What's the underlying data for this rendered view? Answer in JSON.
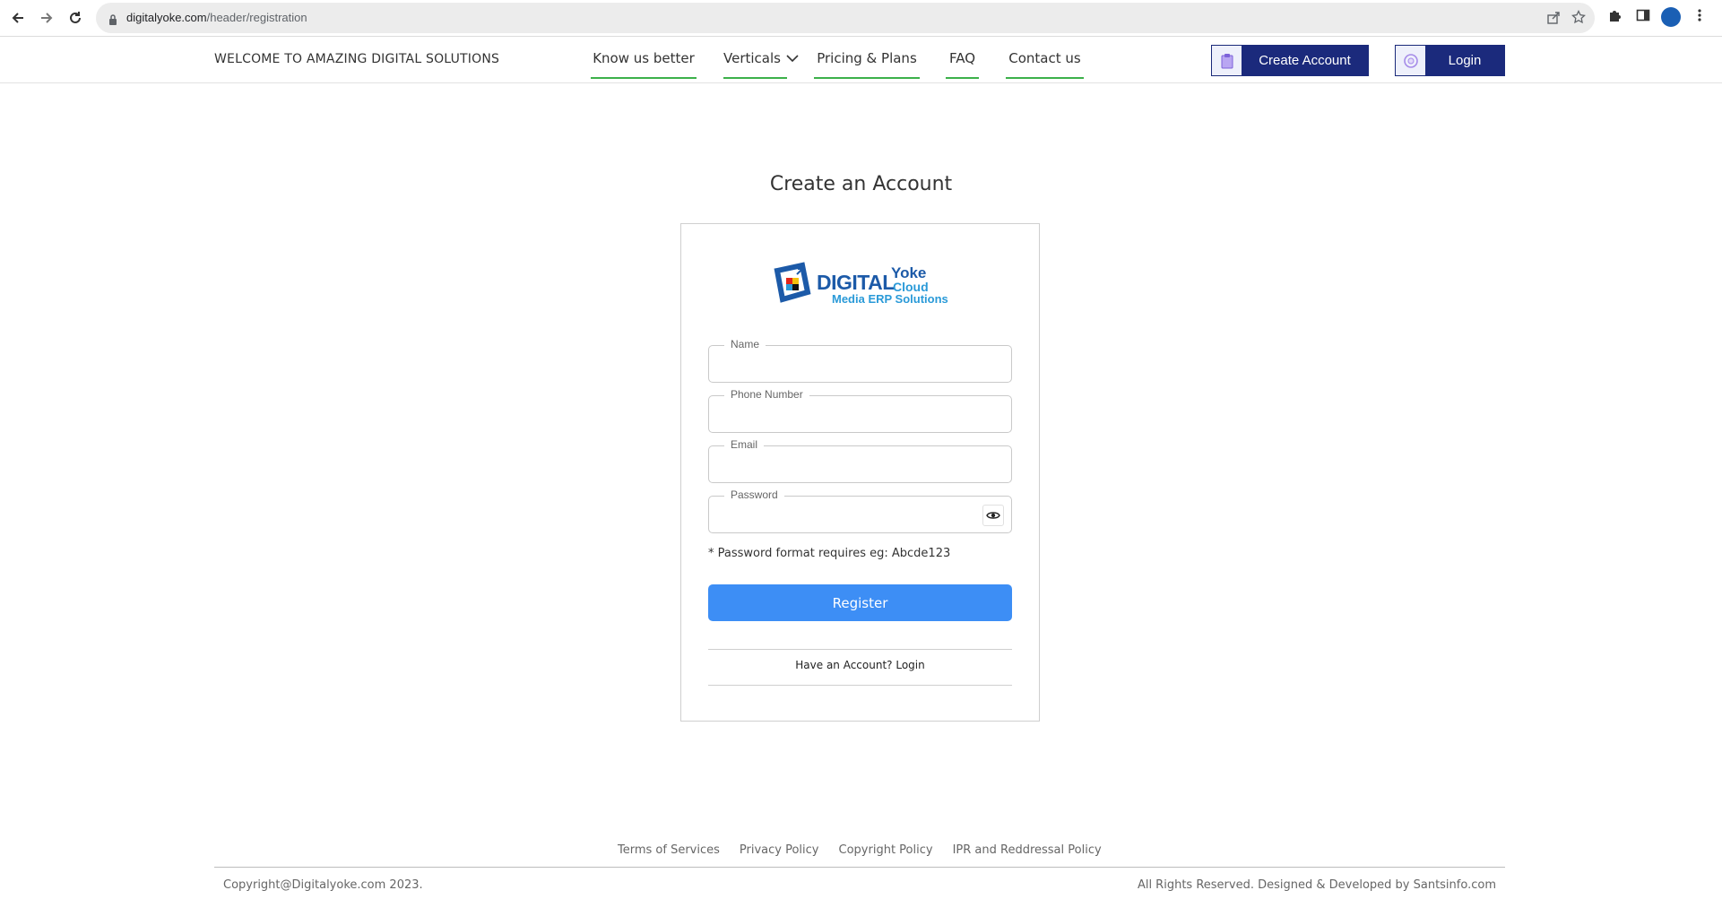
{
  "browser": {
    "url_host": "digitalyoke.com",
    "url_path": "/header/registration"
  },
  "header": {
    "welcome": "WELCOME TO AMAZING DIGITAL SOLUTIONS",
    "nav": [
      "Know us better",
      "Verticals",
      "Pricing & Plans",
      "FAQ",
      "Contact us"
    ],
    "create_account": "Create Account",
    "login": "Login",
    "accent_color": "#3cb04a",
    "button_color": "#1b2a7c"
  },
  "main": {
    "title": "Create an Account",
    "logo": {
      "digital": "DIGITAL",
      "yoke": "Yoke",
      "cloud": "Cloud",
      "tagline": "Media ERP Solutions"
    },
    "fields": {
      "name": "Name",
      "phone": "Phone Number",
      "email": "Email",
      "password": "Password"
    },
    "password_hint": "* Password format requires eg: Abcde123",
    "register": "Register",
    "have_account": "Have an Account? Login",
    "register_color": "#3d8ef5"
  },
  "footer": {
    "links": [
      "Terms of Services",
      "Privacy Policy",
      "Copyright Policy",
      "IPR and Reddressal Policy"
    ],
    "copyright": "Copyright@Digitalyoke.com 2023.",
    "rights": "All Rights Reserved. Designed & Developed by Santsinfo.com"
  }
}
